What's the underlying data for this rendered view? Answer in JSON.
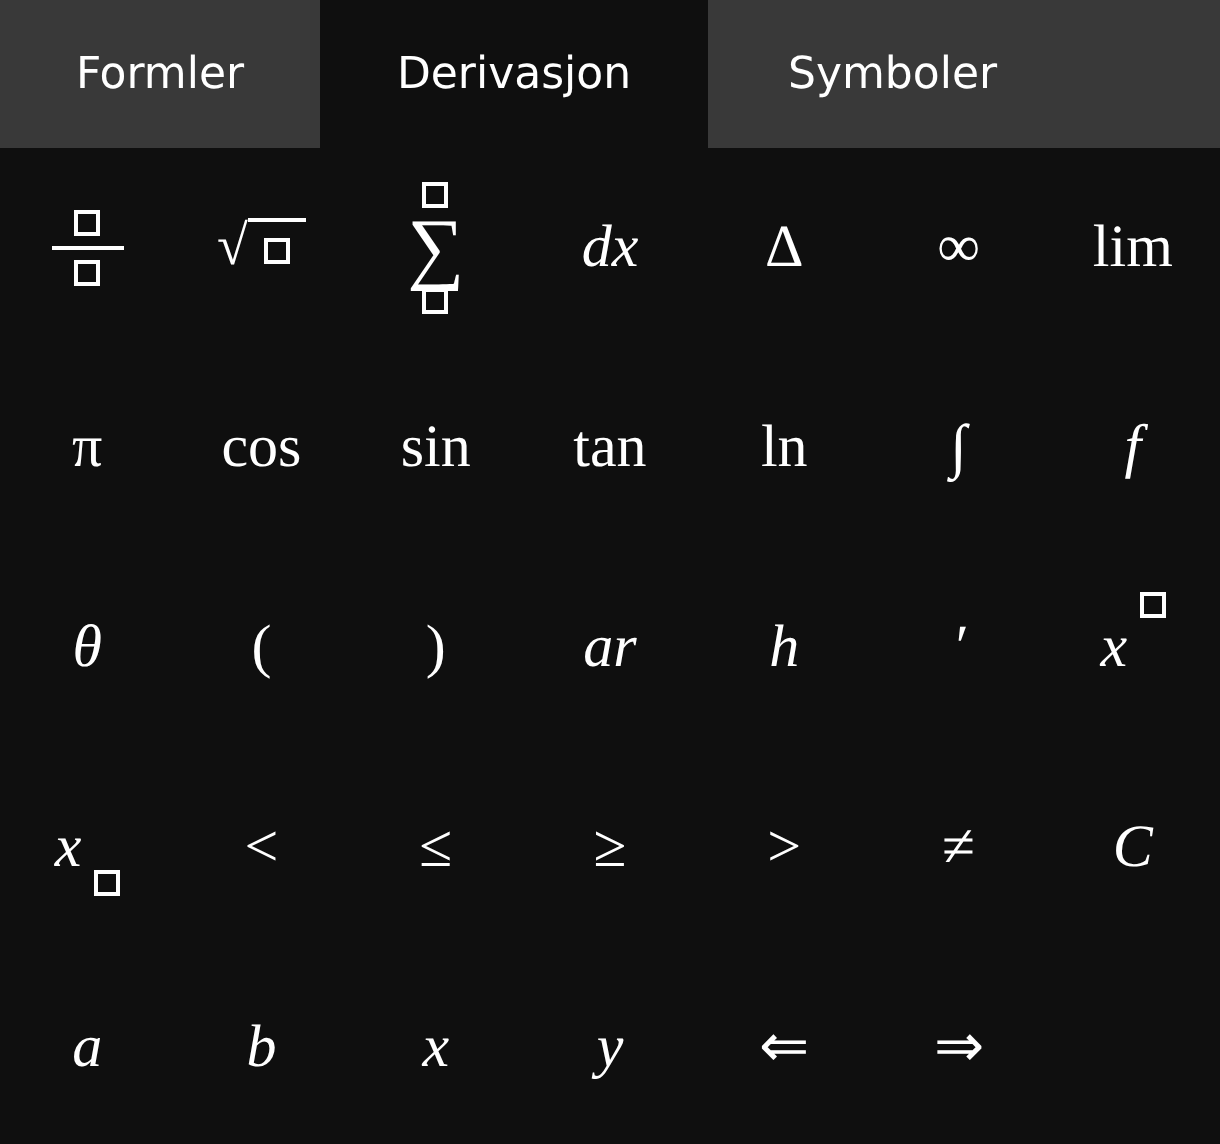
{
  "tabs": [
    {
      "label": "Formler",
      "selected": false
    },
    {
      "label": "Derivasjon",
      "selected": true
    },
    {
      "label": "Symboler",
      "selected": false
    }
  ],
  "keys": [
    {
      "kind": "fraction"
    },
    {
      "kind": "root",
      "symbol": "√"
    },
    {
      "kind": "sum",
      "symbol": "∑"
    },
    {
      "kind": "text",
      "symbol": "dx",
      "italic": true
    },
    {
      "kind": "text",
      "symbol": "Δ",
      "italic": false
    },
    {
      "kind": "text",
      "symbol": "∞",
      "italic": false
    },
    {
      "kind": "text",
      "symbol": "lim",
      "italic": false
    },
    {
      "kind": "text",
      "symbol": "π",
      "italic": false
    },
    {
      "kind": "text",
      "symbol": "cos",
      "italic": false
    },
    {
      "kind": "text",
      "symbol": "sin",
      "italic": false
    },
    {
      "kind": "text",
      "symbol": "tan",
      "italic": false
    },
    {
      "kind": "text",
      "symbol": "ln",
      "italic": false
    },
    {
      "kind": "text",
      "symbol": "∫"
    },
    {
      "kind": "text",
      "symbol": "f",
      "italic": true
    },
    {
      "kind": "text",
      "symbol": "θ",
      "italic": true
    },
    {
      "kind": "text",
      "symbol": "(",
      "italic": false
    },
    {
      "kind": "text",
      "symbol": ")",
      "italic": false
    },
    {
      "kind": "text",
      "symbol": "ar",
      "italic": true
    },
    {
      "kind": "text",
      "symbol": "h",
      "italic": true
    },
    {
      "kind": "text",
      "symbol": "′",
      "italic": true
    },
    {
      "kind": "power",
      "symbol": "x"
    },
    {
      "kind": "subscript",
      "symbol": "x"
    },
    {
      "kind": "text",
      "symbol": "<",
      "italic": false
    },
    {
      "kind": "text",
      "symbol": "≤",
      "italic": false
    },
    {
      "kind": "text",
      "symbol": "≥",
      "italic": false
    },
    {
      "kind": "text",
      "symbol": ">",
      "italic": false
    },
    {
      "kind": "text",
      "symbol": "≠",
      "italic": false
    },
    {
      "kind": "text",
      "symbol": "C",
      "italic": true
    },
    {
      "kind": "text",
      "symbol": "a",
      "italic": true
    },
    {
      "kind": "text",
      "symbol": "b",
      "italic": true
    },
    {
      "kind": "text",
      "symbol": "x",
      "italic": true
    },
    {
      "kind": "text",
      "symbol": "y",
      "italic": true
    },
    {
      "kind": "text",
      "symbol": "⇐",
      "italic": false
    },
    {
      "kind": "text",
      "symbol": "⇒",
      "italic": false
    }
  ]
}
